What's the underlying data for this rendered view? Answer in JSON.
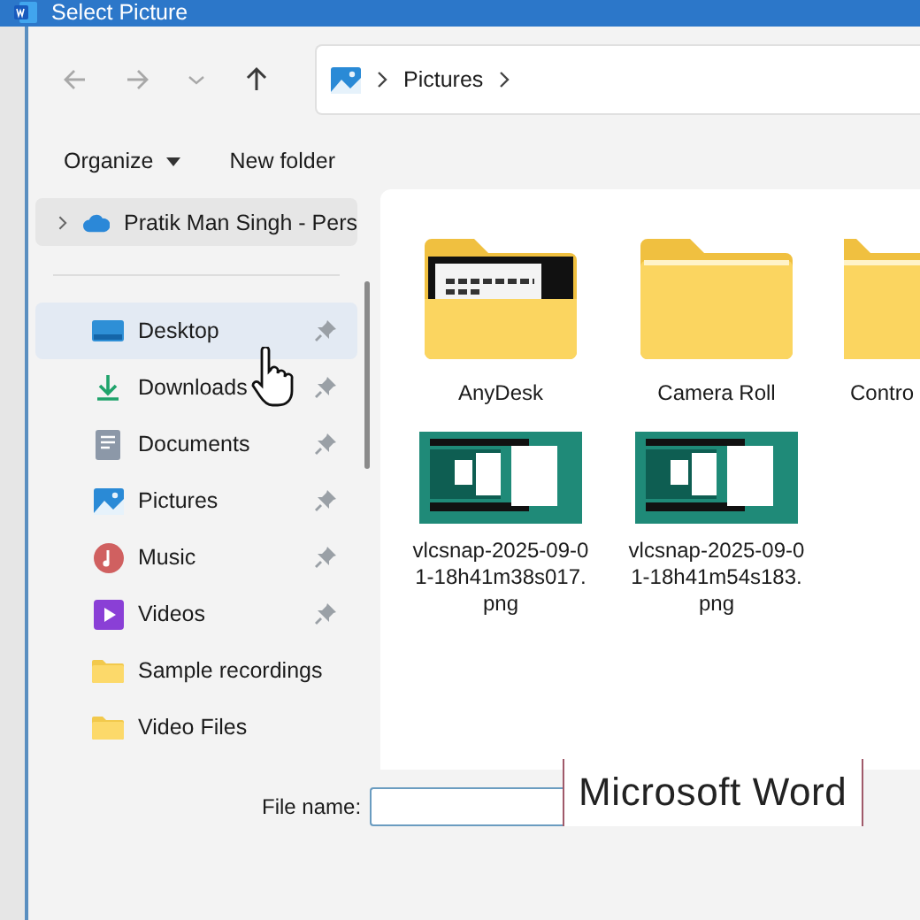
{
  "window": {
    "title": "Select Picture"
  },
  "nav_buttons": [
    {
      "kind": "back",
      "disabled": true
    },
    {
      "kind": "forward",
      "disabled": true
    },
    {
      "kind": "recent",
      "disabled": true
    },
    {
      "kind": "up",
      "disabled": false
    }
  ],
  "address_bar": {
    "path": [
      "Pictures"
    ]
  },
  "toolbar": {
    "buttons": [
      {
        "label": "Organize",
        "has_menu": true
      },
      {
        "label": "New folder",
        "has_menu": false
      }
    ]
  },
  "sidebar": {
    "account": {
      "label": "Pratik Man Singh - Pers",
      "expanded": false
    },
    "items": [
      {
        "label": "Desktop",
        "kind": "desktop",
        "pinned": true,
        "selected": true
      },
      {
        "label": "Downloads",
        "kind": "download",
        "pinned": true,
        "selected": false
      },
      {
        "label": "Documents",
        "kind": "document",
        "pinned": true,
        "selected": false
      },
      {
        "label": "Pictures",
        "kind": "picture",
        "pinned": true,
        "selected": false
      },
      {
        "label": "Music",
        "kind": "music",
        "pinned": true,
        "selected": false
      },
      {
        "label": "Videos",
        "kind": "video",
        "pinned": true,
        "selected": false
      },
      {
        "label": "Sample recordings",
        "kind": "folder",
        "pinned": false,
        "selected": false
      },
      {
        "label": "Video Files",
        "kind": "folder",
        "pinned": false,
        "selected": false
      }
    ]
  },
  "files": [
    {
      "name": "AnyDesk",
      "kind": "folder-preview"
    },
    {
      "name": "Camera Roll",
      "kind": "folder"
    },
    {
      "name": "Contro",
      "kind": "folder"
    },
    {
      "name": "vlcsnap-2025-09-01-18h41m38s017.png",
      "kind": "image"
    },
    {
      "name": "vlcsnap-2025-09-01-18h41m54s183.png",
      "kind": "image"
    }
  ],
  "file_name": {
    "label": "File name:"
  },
  "overlay": {
    "caption": "Microsoft Word"
  }
}
